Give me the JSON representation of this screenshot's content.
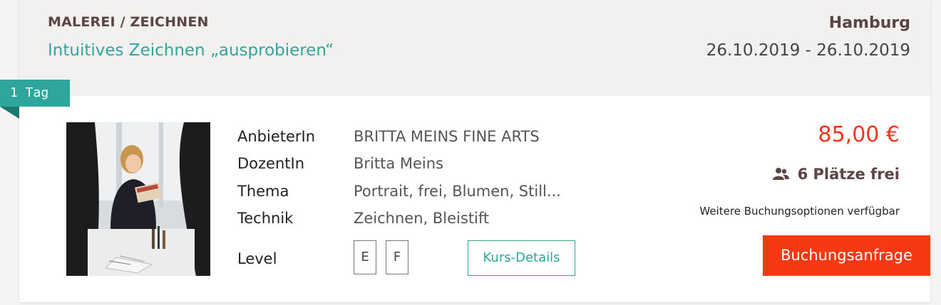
{
  "course": {
    "category": "MALEREI / ZEICHNEN",
    "title": "Intuitives Zeichnen „ausprobieren“",
    "city": "Hamburg",
    "dates": "26.10.2019 - 26.10.2019",
    "duration_badge": "1 Tag"
  },
  "details": {
    "rows": [
      {
        "label": "AnbieterIn",
        "value": "BRITTA MEINS FINE ARTS"
      },
      {
        "label": "DozentIn",
        "value": "Britta Meins"
      },
      {
        "label": "Thema",
        "value": "Portrait, frei, Blumen, Still..."
      },
      {
        "label": "Technik",
        "value": "Zeichnen, Bleistift"
      }
    ],
    "level_label": "Level",
    "levels": [
      "E",
      "F"
    ],
    "details_button": "Kurs-Details"
  },
  "booking": {
    "price": "85,00 €",
    "seats": "6 Plätze frei",
    "seats_icon": "users-icon",
    "options_text": "Weitere Buchungsoptionen verfügbar",
    "book_button": "Buchungsanfrage"
  },
  "colors": {
    "accent_teal": "#2ea69c",
    "price_red": "#f0361c",
    "button_red": "#f53913",
    "header_bg": "#f3f0f0"
  }
}
